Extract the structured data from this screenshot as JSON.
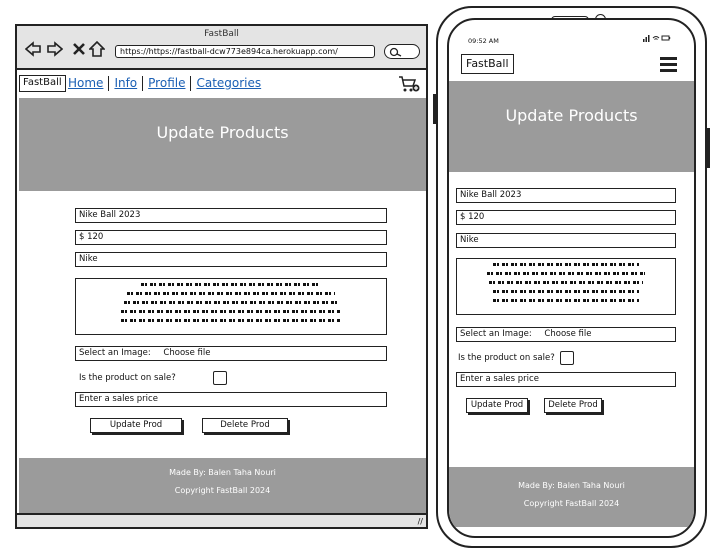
{
  "desktop": {
    "window_title": "FastBall",
    "url": "https://https://fastball-dcw773e894ca.herokuapp.com/",
    "logo": "FastBall",
    "nav": [
      "Home",
      "Info",
      "Profile",
      "Categories"
    ],
    "hero_title": "Update Products",
    "form": {
      "name": "Nike Ball 2023",
      "price": "$ 120",
      "brand": "Nike",
      "image_label": "Select an Image:",
      "choose_file": "Choose file",
      "sale_question": "Is the product on sale?",
      "sale_price_placeholder": "Enter a sales price",
      "update_button": "Update Prod",
      "delete_button": "Delete Prod"
    },
    "footer": {
      "made_by": "Made By: Balen Taha Nouri",
      "copyright": "Copyright FastBall 2024"
    }
  },
  "mobile": {
    "time": "09:52 AM",
    "logo": "FastBall",
    "hero_title": "Update Products",
    "form": {
      "name": "Nike Ball 2023",
      "price": "$ 120",
      "brand": "Nike",
      "image_label": "Select an Image:",
      "choose_file": "Choose file",
      "sale_question": "Is the product on sale?",
      "sale_price_placeholder": "Enter a sales price",
      "update_button": "Update Prod",
      "delete_button": "Delete Prod"
    },
    "footer": {
      "made_by": "Made By: Balen Taha Nouri",
      "copyright": "Copyright FastBall 2024"
    }
  },
  "colors": {
    "hero_bg": "#9b9b9b",
    "link": "#1a5fb4",
    "chrome": "#e4e4e4"
  }
}
